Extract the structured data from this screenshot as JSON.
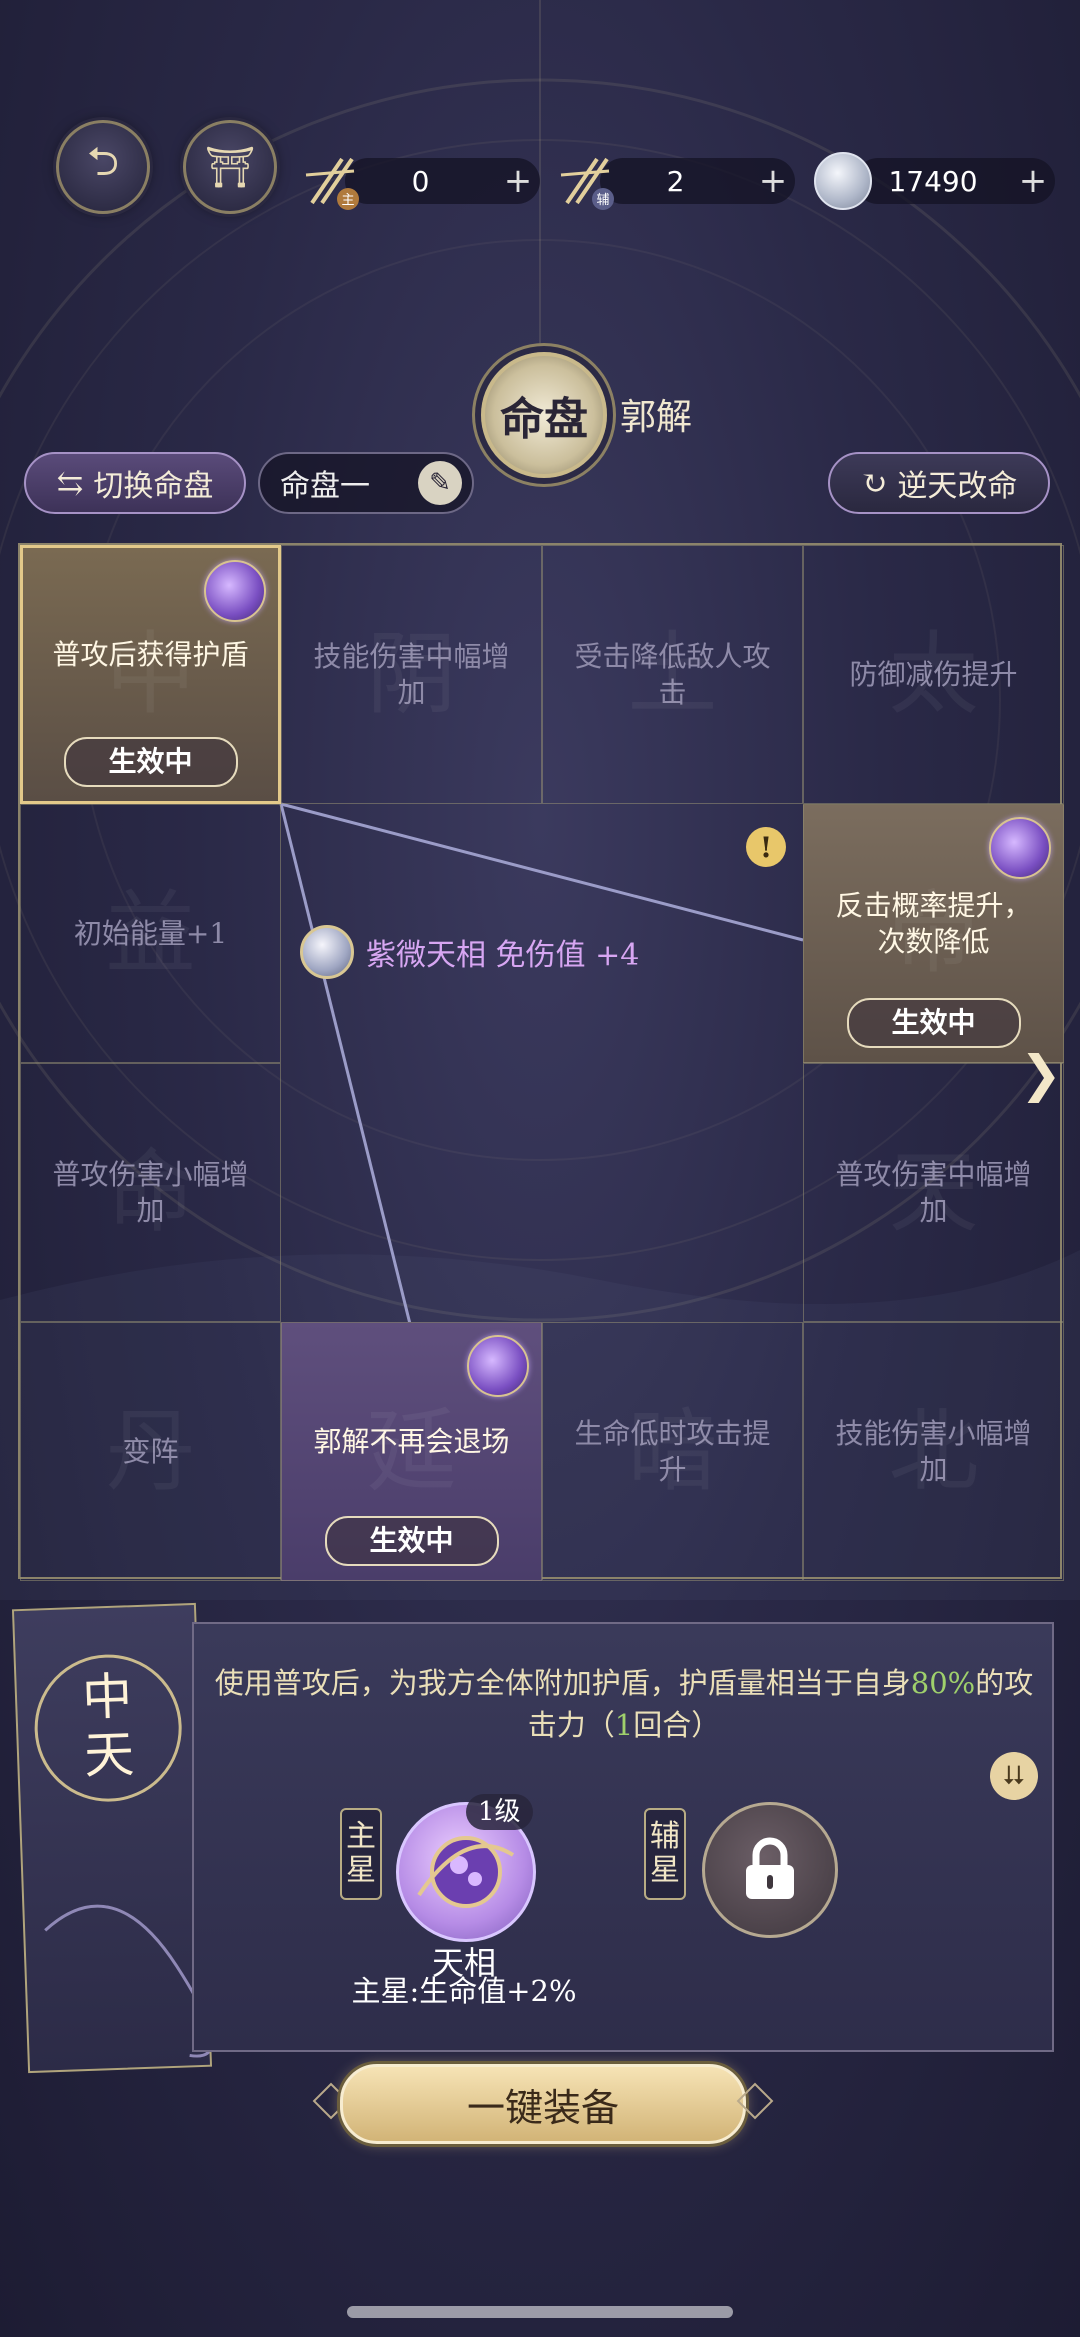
{
  "header": {
    "back_icon": "back-arrow-icon",
    "pavilion_icon": "pavilion-icon",
    "currencies": [
      {
        "icon": "main-star-token-icon",
        "badge": "主",
        "value": "0",
        "plus": "+"
      },
      {
        "icon": "aux-star-token-icon",
        "badge": "辅",
        "value": "2",
        "plus": "+"
      },
      {
        "icon": "silver-coin-icon",
        "value": "17490",
        "plus": "+"
      }
    ]
  },
  "title": {
    "medal": "命盘",
    "character": "郭解"
  },
  "toolbar": {
    "switch_label": "切换命盘",
    "chart_name": "命盘一",
    "reverse_label": "逆天改命"
  },
  "grid": {
    "active_label": "生效中",
    "cells": [
      {
        "text": "普攻后获得护盾",
        "bg": "中",
        "state": "active-gold"
      },
      {
        "text": "技能伤害中幅增加",
        "bg": "阴"
      },
      {
        "text": "受击降低敌人攻击",
        "bg": "土"
      },
      {
        "text": "防御减伤提升",
        "bg": "太"
      },
      {
        "text": "初始能量+1",
        "bg": "益"
      },
      {
        "text": "反击概率提升，次数降低",
        "bg": "帝",
        "state": "active-tan"
      },
      {
        "text": "普攻伤害小幅增加",
        "bg": "命"
      },
      {
        "text": "普攻伤害中幅增加",
        "bg": "天"
      },
      {
        "text": "变阵",
        "bg": "丹"
      },
      {
        "text": "郭解不再会退场",
        "bg": "延",
        "state": "active-purple"
      },
      {
        "text": "生命低时攻击提升",
        "bg": "暗"
      },
      {
        "text": "技能伤害小幅增加",
        "bg": "北"
      }
    ],
    "center_text": "紫微天相 免伤值 +4",
    "warning_mark": "!"
  },
  "detail": {
    "slot_name": "中天",
    "description_prefix": "使用普攻后，为我方全体附加护盾，护盾量相当于自身",
    "description_pct": "80%",
    "description_mid": "的攻击力（",
    "description_turns": "1",
    "description_suffix": "回合）",
    "main_star_label": "主星",
    "aux_star_label": "辅星",
    "level": "1级",
    "star_name": "天相",
    "star_bonus": "主星:生命值+2%"
  },
  "equip_label": "一键装备",
  "colors": {
    "accent_gold": "#e3c98a",
    "active_green": "#9fd06c",
    "bg_dark": "#2a2947"
  }
}
